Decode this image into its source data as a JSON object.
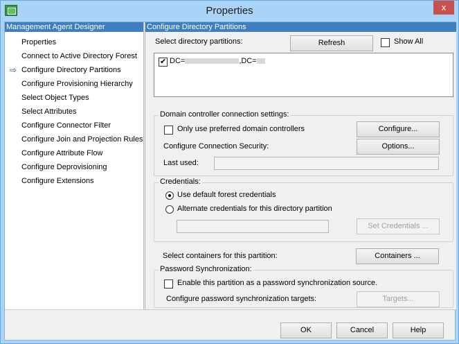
{
  "window": {
    "title": "Properties",
    "close_label": "x"
  },
  "left_pane": {
    "header": "Management Agent Designer",
    "items": [
      {
        "label": "Properties",
        "current": false
      },
      {
        "label": "Connect to Active Directory Forest",
        "current": false
      },
      {
        "label": "Configure Directory Partitions",
        "current": true
      },
      {
        "label": "Configure Provisioning Hierarchy",
        "current": false
      },
      {
        "label": "Select Object Types",
        "current": false
      },
      {
        "label": "Select Attributes",
        "current": false
      },
      {
        "label": "Configure Connector Filter",
        "current": false
      },
      {
        "label": "Configure Join and Projection Rules",
        "current": false
      },
      {
        "label": "Configure Attribute Flow",
        "current": false
      },
      {
        "label": "Configure Deprovisioning",
        "current": false
      },
      {
        "label": "Configure Extensions",
        "current": false
      }
    ]
  },
  "right_pane": {
    "header": "Configure Directory Partitions",
    "select_partitions_label": "Select directory partitions:",
    "refresh_button": "Refresh",
    "show_all_label": "Show All",
    "show_all_checked": false,
    "partitions": [
      {
        "prefix": "DC=",
        "mid": ",DC=",
        "checked": true
      }
    ],
    "dc_group": {
      "title": "Domain controller connection settings:",
      "preferred_label": "Only use preferred domain controllers",
      "preferred_checked": false,
      "configure_button": "Configure...",
      "security_label": "Configure Connection Security:",
      "options_button": "Options...",
      "last_used_label": "Last used:",
      "last_used_value": ""
    },
    "credentials_group": {
      "title": "Credentials:",
      "default_option": "Use default forest credentials",
      "alternate_option": "Alternate credentials for this directory partition",
      "selected": "default",
      "credentials_value": "",
      "set_credentials_button": "Set Credentials ..."
    },
    "containers_label": "Select containers for this partition:",
    "containers_button": "Containers ...",
    "password_group": {
      "title": "Password Synchronization:",
      "enable_label": "Enable this partition as a password synchronization source.",
      "enable_checked": false,
      "targets_label": "Configure password synchronization targets:",
      "targets_button": "Targets..."
    }
  },
  "footer": {
    "ok": "OK",
    "cancel": "Cancel",
    "help": "Help"
  }
}
